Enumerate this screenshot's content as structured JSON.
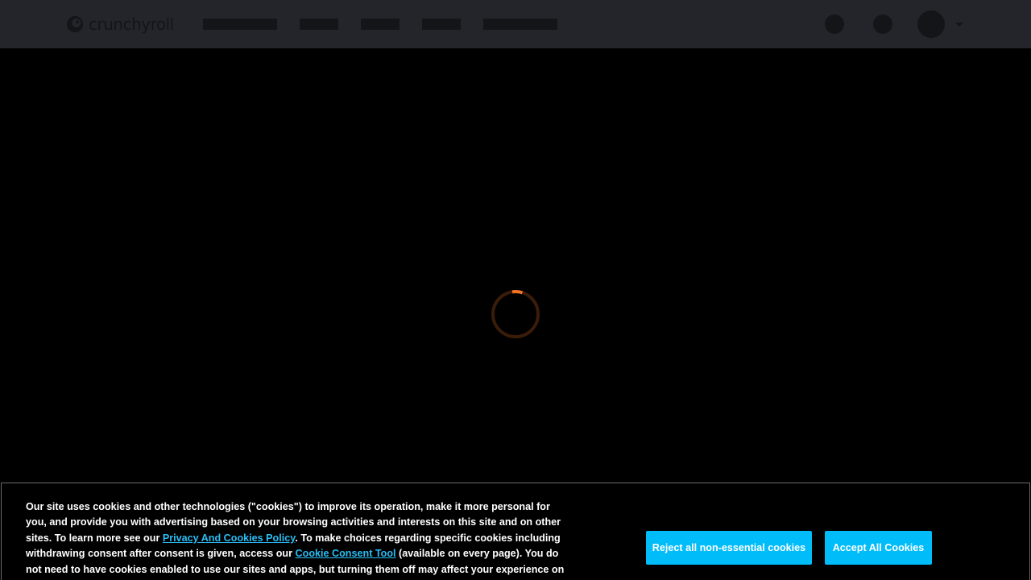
{
  "header": {
    "logo_text": "crunchyroll",
    "nav_placeholders": [
      {
        "name": "nav-item-1"
      },
      {
        "name": "nav-item-2"
      },
      {
        "name": "nav-item-3"
      },
      {
        "name": "nav-item-4"
      },
      {
        "name": "nav-item-5"
      }
    ],
    "icons": [
      "search-icon",
      "bookmark-icon",
      "avatar",
      "chevron-down-icon"
    ]
  },
  "main": {
    "loading_indicator": "loading-spinner-icon"
  },
  "cookie_banner": {
    "text_part1": "Our site uses cookies and other technologies (\"cookies\") to improve its operation, make it more personal for you, and provide you with advertising based on your browsing activities and interests on this site and on other sites. To learn more see our ",
    "privacy_link": "Privacy And Cookies Policy",
    "text_part2": ". To make choices regarding specific cookies including withdrawing consent after consent is given, access our ",
    "consent_tool_link": "Cookie Consent Tool",
    "text_part3": " (available on every page). You do not need to have cookies enabled to use our sites and apps, but turning them off may affect your experience on our sites and apps. By clicking",
    "reject_label": "Reject all non-essential cookies",
    "accept_label": "Accept All Cookies"
  },
  "colors": {
    "header_bg": "#23252b",
    "placeholder": "#141519",
    "accent_orange": "#f47521",
    "button_blue": "#00bcf9",
    "link_blue": "#2abdf5"
  }
}
